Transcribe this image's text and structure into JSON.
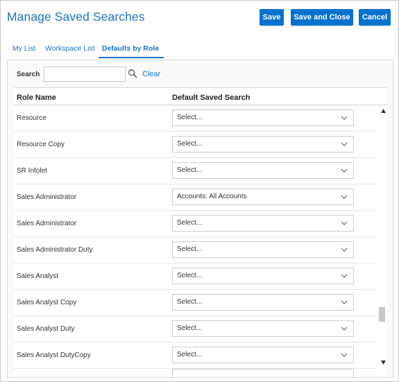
{
  "dialog": {
    "title": "Manage Saved Searches",
    "buttons": {
      "save": "Save",
      "save_and_close": "Save and Close",
      "cancel": "Cancel"
    },
    "accent_color": "#1e73c5",
    "button_color": "#0572ce"
  },
  "tabs": [
    {
      "label": "My List",
      "selected": false
    },
    {
      "label": "Workspace List",
      "selected": false
    },
    {
      "label": "Defaults by Role",
      "selected": true
    }
  ],
  "search": {
    "label": "Search",
    "value": "",
    "placeholder": "",
    "clear_label": "Clear"
  },
  "table": {
    "columns": [
      "Role Name",
      "Default Saved Search"
    ],
    "rows": [
      {
        "role": "Resource",
        "default": "Select..."
      },
      {
        "role": "Resource Copy",
        "default": "Select..."
      },
      {
        "role": "SR Infolet",
        "default": "Select..."
      },
      {
        "role": "Sales Administrator",
        "default": "Accounts: All Accounts"
      },
      {
        "role": "Sales Administrator",
        "default": "Select..."
      },
      {
        "role": "Sales Administrator Duty",
        "default": "Select..."
      },
      {
        "role": "Sales Analyst",
        "default": "Select..."
      },
      {
        "role": "Sales Analyst Copy",
        "default": "Select..."
      },
      {
        "role": "Sales Analyst Duty",
        "default": "Select..."
      },
      {
        "role": "Sales Analyst DutyCopy",
        "default": "Select..."
      }
    ]
  },
  "icons": {
    "search": "search-icon",
    "dropdown": "chevron-down-icon",
    "scroll_up": "arrow-up-icon",
    "scroll_down": "arrow-down-icon"
  }
}
